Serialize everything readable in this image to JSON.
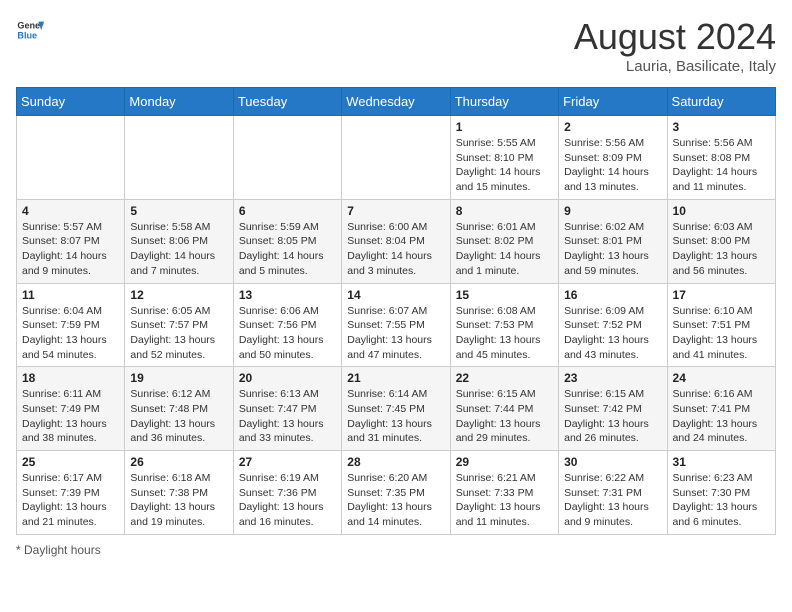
{
  "logo": {
    "line1": "General",
    "line2": "Blue"
  },
  "title": "August 2024",
  "subtitle": "Lauria, Basilicate, Italy",
  "days_of_week": [
    "Sunday",
    "Monday",
    "Tuesday",
    "Wednesday",
    "Thursday",
    "Friday",
    "Saturday"
  ],
  "weeks": [
    [
      {
        "day": "",
        "sunrise": "",
        "sunset": "",
        "daylight": ""
      },
      {
        "day": "",
        "sunrise": "",
        "sunset": "",
        "daylight": ""
      },
      {
        "day": "",
        "sunrise": "",
        "sunset": "",
        "daylight": ""
      },
      {
        "day": "",
        "sunrise": "",
        "sunset": "",
        "daylight": ""
      },
      {
        "day": "1",
        "sunrise": "5:55 AM",
        "sunset": "8:10 PM",
        "daylight": "14 hours and 15 minutes."
      },
      {
        "day": "2",
        "sunrise": "5:56 AM",
        "sunset": "8:09 PM",
        "daylight": "14 hours and 13 minutes."
      },
      {
        "day": "3",
        "sunrise": "5:56 AM",
        "sunset": "8:08 PM",
        "daylight": "14 hours and 11 minutes."
      }
    ],
    [
      {
        "day": "4",
        "sunrise": "5:57 AM",
        "sunset": "8:07 PM",
        "daylight": "14 hours and 9 minutes."
      },
      {
        "day": "5",
        "sunrise": "5:58 AM",
        "sunset": "8:06 PM",
        "daylight": "14 hours and 7 minutes."
      },
      {
        "day": "6",
        "sunrise": "5:59 AM",
        "sunset": "8:05 PM",
        "daylight": "14 hours and 5 minutes."
      },
      {
        "day": "7",
        "sunrise": "6:00 AM",
        "sunset": "8:04 PM",
        "daylight": "14 hours and 3 minutes."
      },
      {
        "day": "8",
        "sunrise": "6:01 AM",
        "sunset": "8:02 PM",
        "daylight": "14 hours and 1 minute."
      },
      {
        "day": "9",
        "sunrise": "6:02 AM",
        "sunset": "8:01 PM",
        "daylight": "13 hours and 59 minutes."
      },
      {
        "day": "10",
        "sunrise": "6:03 AM",
        "sunset": "8:00 PM",
        "daylight": "13 hours and 56 minutes."
      }
    ],
    [
      {
        "day": "11",
        "sunrise": "6:04 AM",
        "sunset": "7:59 PM",
        "daylight": "13 hours and 54 minutes."
      },
      {
        "day": "12",
        "sunrise": "6:05 AM",
        "sunset": "7:57 PM",
        "daylight": "13 hours and 52 minutes."
      },
      {
        "day": "13",
        "sunrise": "6:06 AM",
        "sunset": "7:56 PM",
        "daylight": "13 hours and 50 minutes."
      },
      {
        "day": "14",
        "sunrise": "6:07 AM",
        "sunset": "7:55 PM",
        "daylight": "13 hours and 47 minutes."
      },
      {
        "day": "15",
        "sunrise": "6:08 AM",
        "sunset": "7:53 PM",
        "daylight": "13 hours and 45 minutes."
      },
      {
        "day": "16",
        "sunrise": "6:09 AM",
        "sunset": "7:52 PM",
        "daylight": "13 hours and 43 minutes."
      },
      {
        "day": "17",
        "sunrise": "6:10 AM",
        "sunset": "7:51 PM",
        "daylight": "13 hours and 41 minutes."
      }
    ],
    [
      {
        "day": "18",
        "sunrise": "6:11 AM",
        "sunset": "7:49 PM",
        "daylight": "13 hours and 38 minutes."
      },
      {
        "day": "19",
        "sunrise": "6:12 AM",
        "sunset": "7:48 PM",
        "daylight": "13 hours and 36 minutes."
      },
      {
        "day": "20",
        "sunrise": "6:13 AM",
        "sunset": "7:47 PM",
        "daylight": "13 hours and 33 minutes."
      },
      {
        "day": "21",
        "sunrise": "6:14 AM",
        "sunset": "7:45 PM",
        "daylight": "13 hours and 31 minutes."
      },
      {
        "day": "22",
        "sunrise": "6:15 AM",
        "sunset": "7:44 PM",
        "daylight": "13 hours and 29 minutes."
      },
      {
        "day": "23",
        "sunrise": "6:15 AM",
        "sunset": "7:42 PM",
        "daylight": "13 hours and 26 minutes."
      },
      {
        "day": "24",
        "sunrise": "6:16 AM",
        "sunset": "7:41 PM",
        "daylight": "13 hours and 24 minutes."
      }
    ],
    [
      {
        "day": "25",
        "sunrise": "6:17 AM",
        "sunset": "7:39 PM",
        "daylight": "13 hours and 21 minutes."
      },
      {
        "day": "26",
        "sunrise": "6:18 AM",
        "sunset": "7:38 PM",
        "daylight": "13 hours and 19 minutes."
      },
      {
        "day": "27",
        "sunrise": "6:19 AM",
        "sunset": "7:36 PM",
        "daylight": "13 hours and 16 minutes."
      },
      {
        "day": "28",
        "sunrise": "6:20 AM",
        "sunset": "7:35 PM",
        "daylight": "13 hours and 14 minutes."
      },
      {
        "day": "29",
        "sunrise": "6:21 AM",
        "sunset": "7:33 PM",
        "daylight": "13 hours and 11 minutes."
      },
      {
        "day": "30",
        "sunrise": "6:22 AM",
        "sunset": "7:31 PM",
        "daylight": "13 hours and 9 minutes."
      },
      {
        "day": "31",
        "sunrise": "6:23 AM",
        "sunset": "7:30 PM",
        "daylight": "13 hours and 6 minutes."
      }
    ]
  ],
  "footer": "Daylight hours"
}
